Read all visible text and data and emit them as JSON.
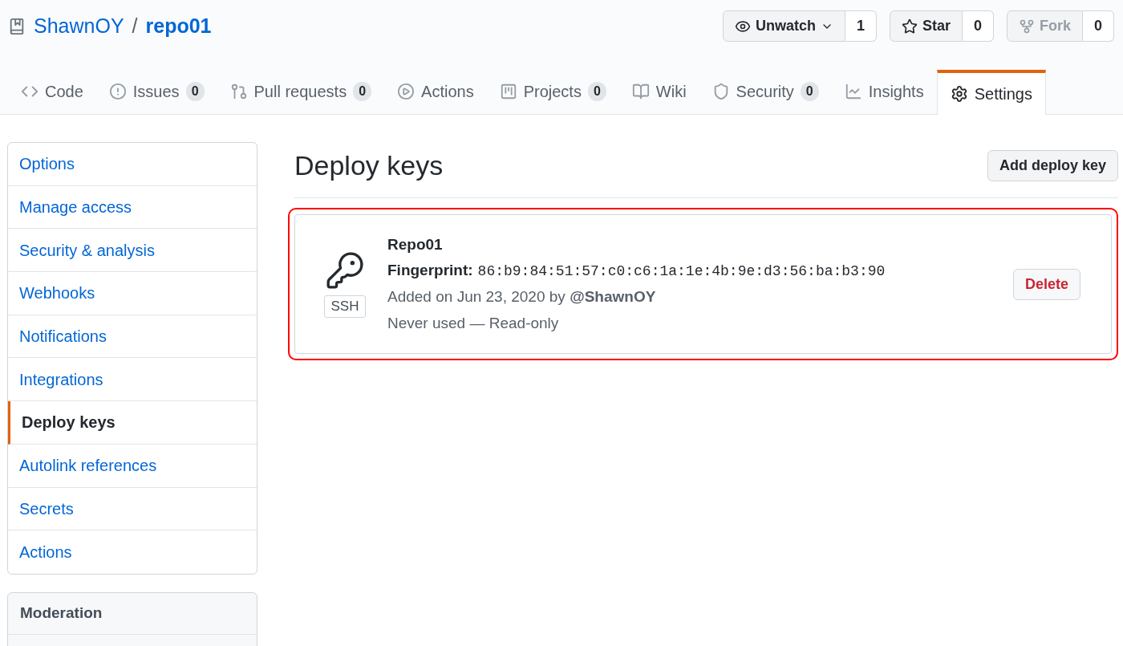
{
  "repo": {
    "owner": "ShawnOY",
    "separator": "/",
    "name": "repo01"
  },
  "actions": [
    {
      "kind": "watch",
      "label": "Unwatch",
      "count": "1",
      "disabled": false
    },
    {
      "kind": "star",
      "label": "Star",
      "count": "0",
      "disabled": false
    },
    {
      "kind": "fork",
      "label": "Fork",
      "count": "0",
      "disabled": true
    }
  ],
  "tabs": [
    {
      "kind": "code",
      "label": "Code",
      "selected": false
    },
    {
      "kind": "issues",
      "label": "Issues",
      "count": "0",
      "selected": false
    },
    {
      "kind": "pulls",
      "label": "Pull requests",
      "count": "0",
      "selected": false
    },
    {
      "kind": "actions",
      "label": "Actions",
      "selected": false
    },
    {
      "kind": "projects",
      "label": "Projects",
      "count": "0",
      "selected": false
    },
    {
      "kind": "wiki",
      "label": "Wiki",
      "selected": false
    },
    {
      "kind": "security",
      "label": "Security",
      "count": "0",
      "selected": false
    },
    {
      "kind": "insights",
      "label": "Insights",
      "selected": false
    },
    {
      "kind": "settings",
      "label": "Settings",
      "selected": true
    }
  ],
  "sidebar": {
    "items": [
      {
        "label": "Options",
        "selected": false
      },
      {
        "label": "Manage access",
        "selected": false
      },
      {
        "label": "Security & analysis",
        "selected": false
      },
      {
        "label": "Webhooks",
        "selected": false
      },
      {
        "label": "Notifications",
        "selected": false
      },
      {
        "label": "Integrations",
        "selected": false
      },
      {
        "label": "Deploy keys",
        "selected": true
      },
      {
        "label": "Autolink references",
        "selected": false
      },
      {
        "label": "Secrets",
        "selected": false
      },
      {
        "label": "Actions",
        "selected": false
      }
    ],
    "moderation": {
      "title": "Moderation"
    }
  },
  "main": {
    "title": "Deploy keys",
    "add_button": "Add deploy key",
    "keys": [
      {
        "type": "SSH",
        "name": "Repo01",
        "fingerprint_label": "Fingerprint:",
        "fingerprint": "86:b9:84:51:57:c0:c6:1a:1e:4b:9e:d3:56:ba:b3:90",
        "added": "Added on Jun 23, 2020 by **@ShawnOY**",
        "usage": "Never used — Read-only",
        "delete_button": "Delete"
      }
    ]
  }
}
